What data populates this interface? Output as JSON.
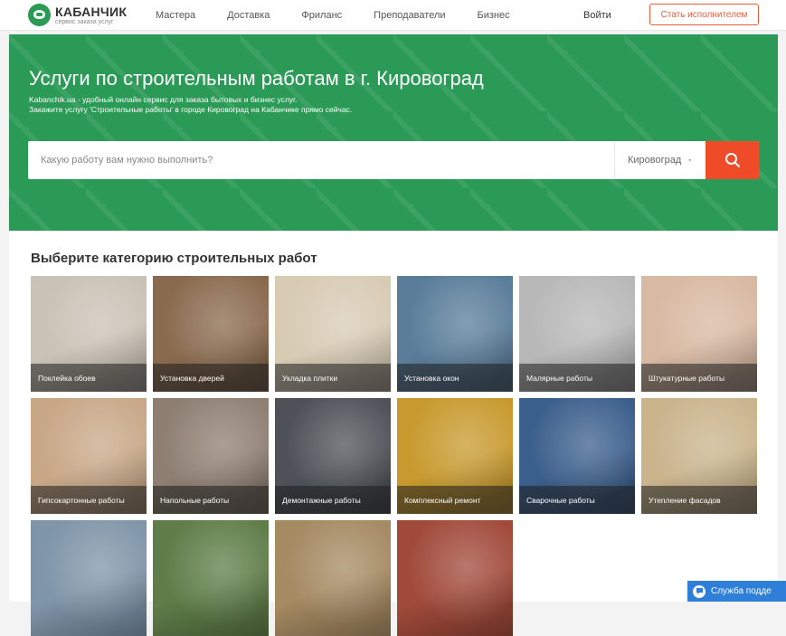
{
  "header": {
    "logo_name": "КАБАНЧИК",
    "logo_sub": "сервис заказа услуг",
    "nav": [
      "Мастера",
      "Доставка",
      "Фриланс",
      "Преподаватели",
      "Бизнес"
    ],
    "login": "Войти",
    "become": "Стать исполнителем"
  },
  "hero": {
    "title": "Услуги по строительным работам в г. Кировоград",
    "desc1": "Kabanchik.ua - удобный онлайн сервис для заказа бытовых и бизнес услуг.",
    "desc2": "Закажите услугу 'Строительные работы' в городе Кировоград на Кабанчике прямо сейчас.",
    "search_placeholder": "Какую работу вам нужно выполнить?",
    "city": "Кировоград"
  },
  "categories_title": "Выберите категорию строительных работ",
  "categories": [
    {
      "label": "Поклейка обоев",
      "bg": "#c9c2b6"
    },
    {
      "label": "Установка дверей",
      "bg": "#8a6a4e"
    },
    {
      "label": "Укладка плитки",
      "bg": "#d7cbb4"
    },
    {
      "label": "Установка окон",
      "bg": "#5a7d9a"
    },
    {
      "label": "Малярные работы",
      "bg": "#b8b8b8"
    },
    {
      "label": "Штукатурные работы",
      "bg": "#d8b9a2"
    },
    {
      "label": "Гипсокартонные работы",
      "bg": "#c8a887"
    },
    {
      "label": "Напольные работы",
      "bg": "#8e7f72"
    },
    {
      "label": "Демонтажные работы",
      "bg": "#4e5258"
    },
    {
      "label": "Комплексный ремонт",
      "bg": "#c89a2e"
    },
    {
      "label": "Сварочные работы",
      "bg": "#3b5f8c"
    },
    {
      "label": "Утепление фасадов",
      "bg": "#c9b48c"
    },
    {
      "label": "",
      "bg": "#7f95a8"
    },
    {
      "label": "",
      "bg": "#5f7d48"
    },
    {
      "label": "",
      "bg": "#a58a62"
    },
    {
      "label": "",
      "bg": "#a14a3a"
    }
  ],
  "support": "Служба подде",
  "colors": {
    "brand_green": "#2a9a56",
    "accent_orange": "#ef4b28",
    "support_blue": "#2f7fd8"
  }
}
